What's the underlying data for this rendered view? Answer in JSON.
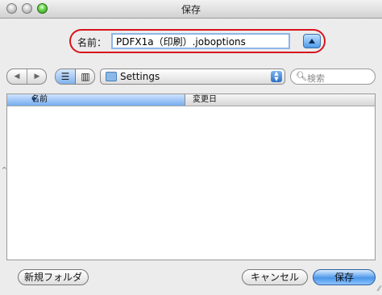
{
  "window": {
    "title": "保存"
  },
  "save_as": {
    "label": "名前：",
    "filename": "PDFX1a（印刷）.joboptions"
  },
  "toolbar": {
    "back": "◀",
    "forward": "▶",
    "list_view_glyph": "☰",
    "column_view_glyph": "▥",
    "location": "Settings",
    "search_placeholder": "検索"
  },
  "browser": {
    "columns": [
      {
        "label": "名前",
        "sorted": true,
        "sort_glyph": "▼"
      },
      {
        "label": "変更日",
        "sorted": false
      }
    ],
    "rows": []
  },
  "buttons": {
    "new_folder": "新規フォルダ",
    "cancel": "キャンセル",
    "save": "保存"
  },
  "colors": {
    "highlight_ring": "#d8141c",
    "accent": "#4b97ea"
  }
}
